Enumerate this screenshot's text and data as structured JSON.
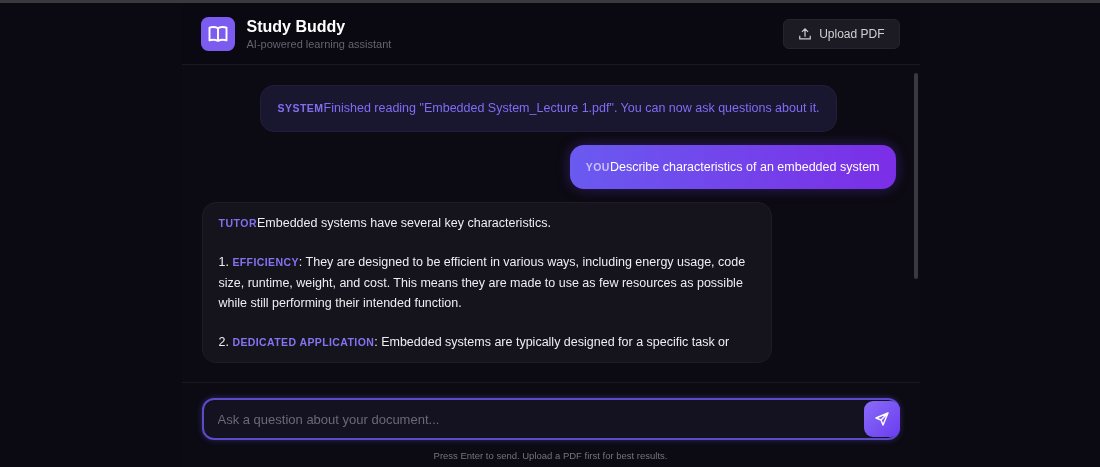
{
  "header": {
    "title": "Study Buddy",
    "subtitle": "AI-powered learning assistant",
    "upload_button": "Upload PDF"
  },
  "messages": [
    {
      "kind": "system",
      "role": "SYSTEM",
      "paragraphs": [
        {
          "text": "Finished reading \"Embedded System_Lecture 1.pdf\". You can now ask questions about it."
        }
      ]
    },
    {
      "kind": "user",
      "role": "YOU",
      "paragraphs": [
        {
          "text": "Describe characteristics of an embedded system"
        }
      ]
    },
    {
      "kind": "tutor",
      "role": "TUTOR",
      "paragraphs": [
        {
          "text": "Embedded systems have several key characteristics."
        },
        {
          "number": "1.",
          "term": "EFFICIENCY",
          "text": ": They are designed to be efficient in various ways, including energy usage, code size, runtime, weight, and cost. This means they are made to use as few resources as possible while still performing their intended function."
        },
        {
          "number": "2.",
          "term": "DEDICATED APPLICATION",
          "text": ": Embedded systems are typically designed for a specific task or"
        }
      ]
    }
  ],
  "composer": {
    "placeholder": "Ask a question about your document...",
    "hint": "Press Enter to send. Upload a PDF first for best results."
  }
}
